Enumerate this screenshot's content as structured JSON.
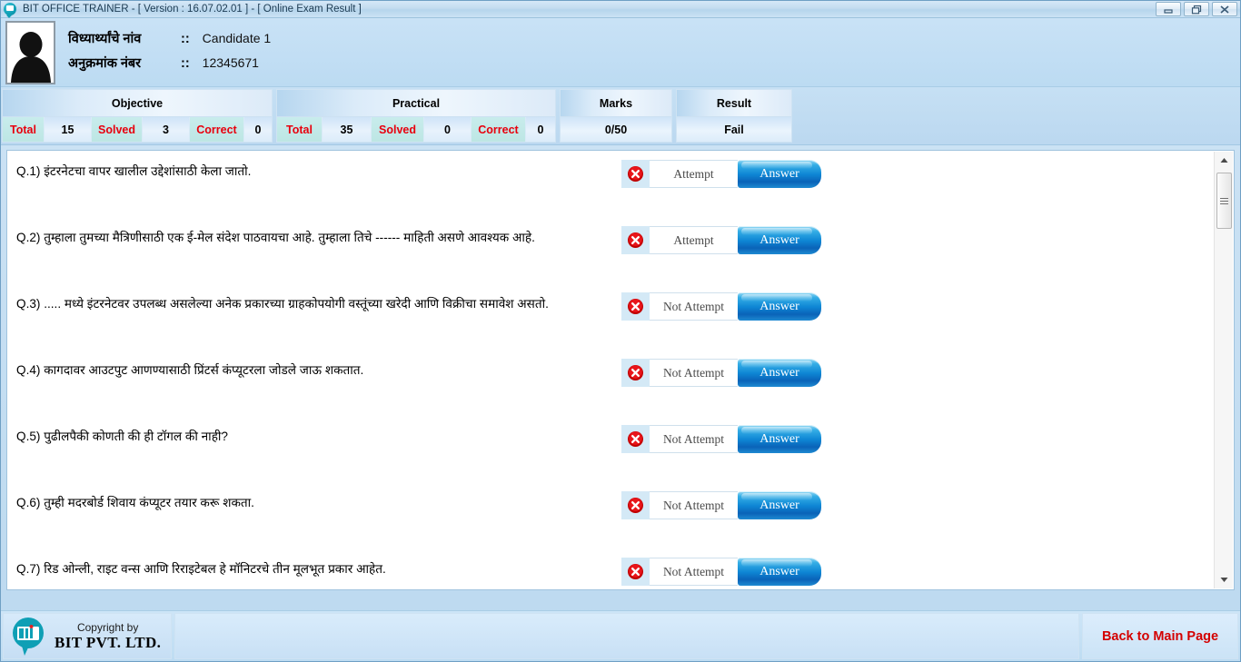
{
  "window": {
    "title": "BIT OFFICE TRAINER - [ Version : 16.07.02.01 ] - [ Online Exam Result ]",
    "app_icon": "bit-logo-icon",
    "minimize_label": "Minimize",
    "restore_label": "Restore",
    "close_label": "Close"
  },
  "candidate": {
    "name_label": "विध्यार्थ्यांचे नांव",
    "name_colons": "::",
    "name_value": "Candidate 1",
    "roll_label": "अनुक्रमांक नंबर",
    "roll_colons": "::",
    "roll_value": "12345671",
    "photo_icon": "person-silhouette-icon"
  },
  "stats": {
    "objective": {
      "title": "Objective",
      "cells": [
        {
          "label": "Total",
          "value": "15"
        },
        {
          "label": "Solved",
          "value": "3"
        },
        {
          "label": "Correct",
          "value": "0"
        }
      ]
    },
    "practical": {
      "title": "Practical",
      "cells": [
        {
          "label": "Total",
          "value": "35"
        },
        {
          "label": "Solved",
          "value": "0"
        },
        {
          "label": "Correct",
          "value": "0"
        }
      ]
    },
    "marks": {
      "title": "Marks",
      "value": "0/50"
    },
    "result": {
      "title": "Result",
      "value": "Fail"
    }
  },
  "questions": [
    {
      "text": "Q.1) इंटरनेटचा वापर खालील उद्देशांसाठी केला जातो.",
      "status": "Attempt",
      "answer_label": "Answer",
      "status_icon": "error-x-icon"
    },
    {
      "text": "Q.2) तुम्हाला तुमच्या मैत्रिणीसाठी एक ई-मेल संदेश पाठवायचा आहे. तुम्हाला तिचे ------ माहिती असणे आवश्यक आहे.",
      "status": "Attempt",
      "answer_label": "Answer",
      "status_icon": "error-x-icon"
    },
    {
      "text": "Q.3) ..... मध्ये इंटरनेटवर उपलब्ध असलेल्या अनेक प्रकारच्या ग्राहकोपयोगी वस्तूंच्या खरेदी आणि विक्रीचा समावेश असतो.",
      "status": "Not Attempt",
      "answer_label": "Answer",
      "status_icon": "error-x-icon"
    },
    {
      "text": "Q.4) कागदावर आउटपुट आणण्यासाठी प्रिंटर्स कंप्यूटरला जोडले जाऊ शकतात.",
      "status": "Not Attempt",
      "answer_label": "Answer",
      "status_icon": "error-x-icon"
    },
    {
      "text": "Q.5) पुढीलपैकी कोणती की ही टॉगल की नाही?",
      "status": "Not Attempt",
      "answer_label": "Answer",
      "status_icon": "error-x-icon"
    },
    {
      "text": "Q.6) तुम्ही मदरबोर्ड शिवाय कंप्यूटर तयार करू शकता.",
      "status": "Not Attempt",
      "answer_label": "Answer",
      "status_icon": "error-x-icon"
    },
    {
      "text": "Q.7) रिड ओन्ली,  राइट वन्स आणि रिराइटेबल हे मॉनिटरचे तीन मूलभूत प्रकार आहेत.",
      "status": "Not Attempt",
      "answer_label": "Answer",
      "status_icon": "error-x-icon"
    }
  ],
  "footer": {
    "copyright_line1": "Copyright by",
    "copyright_line2": "BIT PVT. LTD.",
    "logo_icon": "bit-logo-icon",
    "back_label": "Back to Main Page"
  },
  "colors": {
    "accent_blue": "#0e86d4",
    "label_red": "#e8000d",
    "back_link_red": "#d40000",
    "panel_bg": "#ffffff",
    "chrome_blue": "#c6e0f4",
    "logo_teal": "#0e9fb5"
  }
}
